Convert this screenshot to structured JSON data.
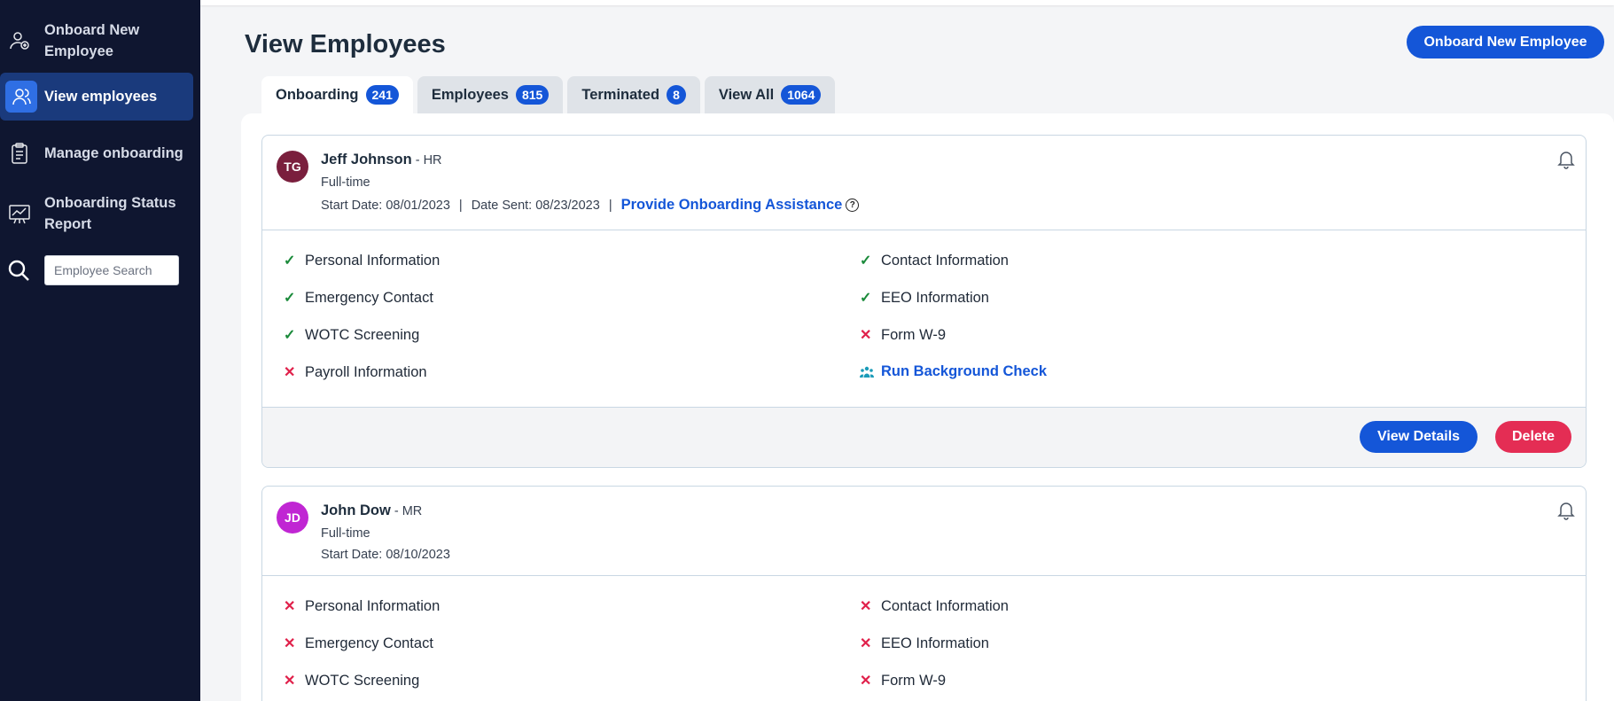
{
  "sidebar": {
    "items": [
      {
        "label": "Onboard New Employee",
        "icon": "user-add-icon"
      },
      {
        "label": "View employees",
        "icon": "users-icon"
      },
      {
        "label": "Manage onboarding",
        "icon": "clipboard-icon"
      },
      {
        "label": "Onboarding Status Report",
        "icon": "chart-board-icon"
      }
    ],
    "search_placeholder": "Employee Search"
  },
  "header": {
    "title": "View Employees",
    "primary_button": "Onboard New Employee"
  },
  "tabs": [
    {
      "label": "Onboarding",
      "count": "241",
      "active": true
    },
    {
      "label": "Employees",
      "count": "815"
    },
    {
      "label": "Terminated",
      "count": "8"
    },
    {
      "label": "View All",
      "count": "1064"
    }
  ],
  "cards": [
    {
      "initials": "TG",
      "avatar_color": "#7a1f3d",
      "name": "Jeff Johnson",
      "role": " - HR",
      "type": "Full-time",
      "start_date": "Start Date: 08/01/2023",
      "date_sent": "Date Sent: 08/23/2023",
      "assist_link": "Provide Onboarding Assistance",
      "items": [
        {
          "label": "Personal Information",
          "status": "done"
        },
        {
          "label": "Contact Information",
          "status": "done"
        },
        {
          "label": "Emergency Contact",
          "status": "done"
        },
        {
          "label": "EEO Information",
          "status": "done"
        },
        {
          "label": "WOTC Screening",
          "status": "done"
        },
        {
          "label": "Form W-9",
          "status": "missing"
        },
        {
          "label": "Payroll Information",
          "status": "missing"
        },
        {
          "label": "Run Background Check",
          "status": "action"
        }
      ],
      "view_details": "View Details",
      "delete": "Delete"
    },
    {
      "initials": "JD",
      "avatar_color": "#c026d3",
      "name": "John Dow",
      "role": " - MR",
      "type": "Full-time",
      "start_date": "Start Date: 08/10/2023",
      "items": [
        {
          "label": "Personal Information",
          "status": "missing"
        },
        {
          "label": "Contact Information",
          "status": "missing"
        },
        {
          "label": "Emergency Contact",
          "status": "missing"
        },
        {
          "label": "EEO Information",
          "status": "missing"
        },
        {
          "label": "WOTC Screening",
          "status": "missing"
        },
        {
          "label": "Form W-9",
          "status": "missing"
        }
      ]
    }
  ],
  "colors": {
    "sidebar_bg": "#0f1630",
    "primary": "#1456d8",
    "danger": "#e42d54",
    "success": "#1a8a3a"
  }
}
